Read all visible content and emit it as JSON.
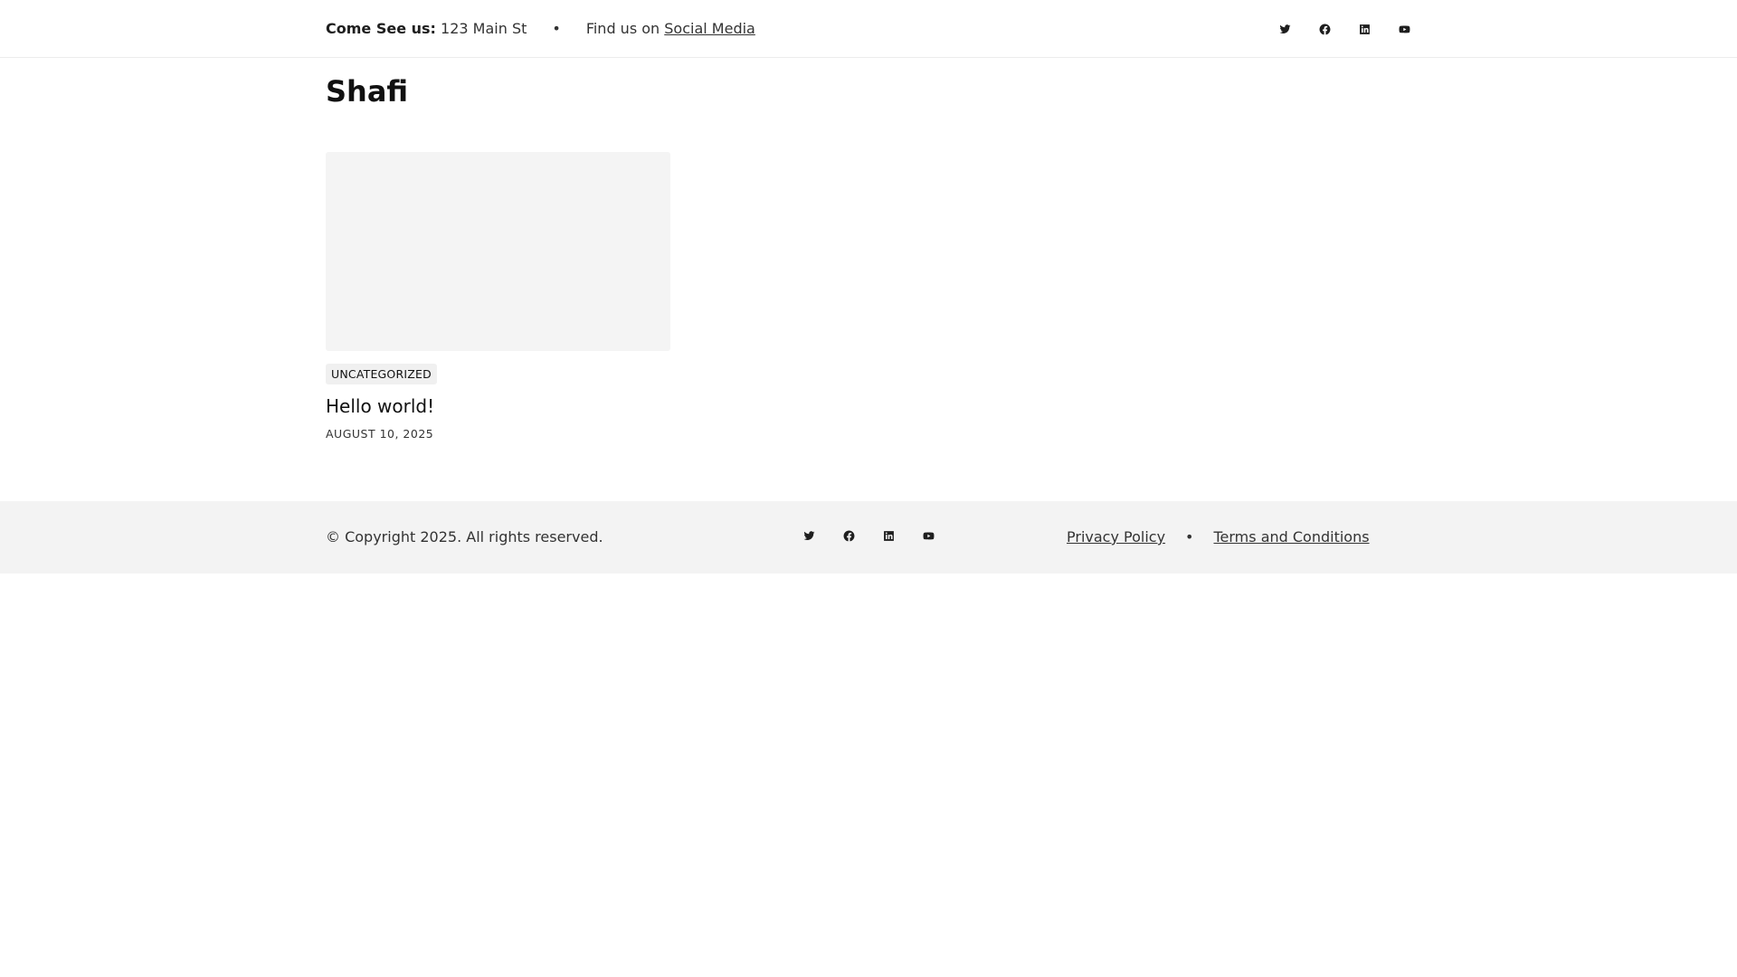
{
  "topbar": {
    "address_label": "Come See us:",
    "address_value": "123 Main St",
    "separator": "•",
    "find_text": "Find us on",
    "find_link": "Social Media",
    "social_icons": [
      "twitter-icon",
      "facebook-icon",
      "linkedin-icon",
      "youtube-icon"
    ]
  },
  "page": {
    "title": "Shafi"
  },
  "posts": [
    {
      "category": "UNCATEGORIZED",
      "title": "Hello world!",
      "date": "AUGUST 10, 2025"
    }
  ],
  "footer": {
    "copyright": "© Copyright 2025. All rights reserved.",
    "social_icons": [
      "twitter-icon",
      "facebook-icon",
      "linkedin-icon",
      "youtube-icon"
    ],
    "privacy": "Privacy Policy",
    "separator": "•",
    "terms": "Terms and Conditions"
  },
  "colors": {
    "text": "#222222",
    "border": "#ececec",
    "thumb_bg": "#f4f4f4",
    "footer_bg": "#f3f3f3"
  }
}
